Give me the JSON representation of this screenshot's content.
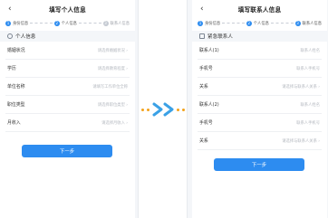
{
  "left": {
    "back_glyph": "‹",
    "title": "填写个人信息",
    "steps": [
      {
        "num": "1",
        "label": "身份信息",
        "active": true
      },
      {
        "num": "2",
        "label": "个人信息",
        "active": true
      },
      {
        "num": "3",
        "label": "联系人信息",
        "active": false
      }
    ],
    "section_title": "个人信息",
    "rows": [
      {
        "label": "婚姻状况",
        "placeholder": "请选择婚姻状况 ›"
      },
      {
        "label": "学历",
        "placeholder": "请选择教育程度 ›"
      },
      {
        "label": "单位名称",
        "placeholder": "请填写工作单位全称"
      },
      {
        "label": "职位类型",
        "placeholder": "请选择职位类型 ›"
      },
      {
        "label": "月收入",
        "placeholder": "请选择月收入 ›"
      }
    ],
    "next_label": "下一步"
  },
  "right": {
    "back_glyph": "‹",
    "title": "填写联系人信息",
    "steps": [
      {
        "num": "1",
        "label": "身份信息",
        "active": true
      },
      {
        "num": "2",
        "label": "个人信息",
        "active": true
      },
      {
        "num": "3",
        "label": "联系人信息",
        "active": true
      }
    ],
    "section_title": "紧急联系人",
    "rows": [
      {
        "label": "联系人(1)",
        "placeholder": "联系人姓名"
      },
      {
        "label": "手机号",
        "placeholder": "联系人手机号"
      },
      {
        "label": "关系",
        "placeholder": "请选择与联系人关系 ›"
      },
      {
        "label": "联系人(2)",
        "placeholder": "联系人姓名"
      },
      {
        "label": "手机号",
        "placeholder": "联系人手机号"
      },
      {
        "label": "关系",
        "placeholder": "请选择与联系人关系 ›"
      }
    ],
    "next_label": "下一步"
  },
  "colors": {
    "accent": "#2d8cf0",
    "arrow": "#3aa1e6",
    "dots": "#f3a21a"
  }
}
